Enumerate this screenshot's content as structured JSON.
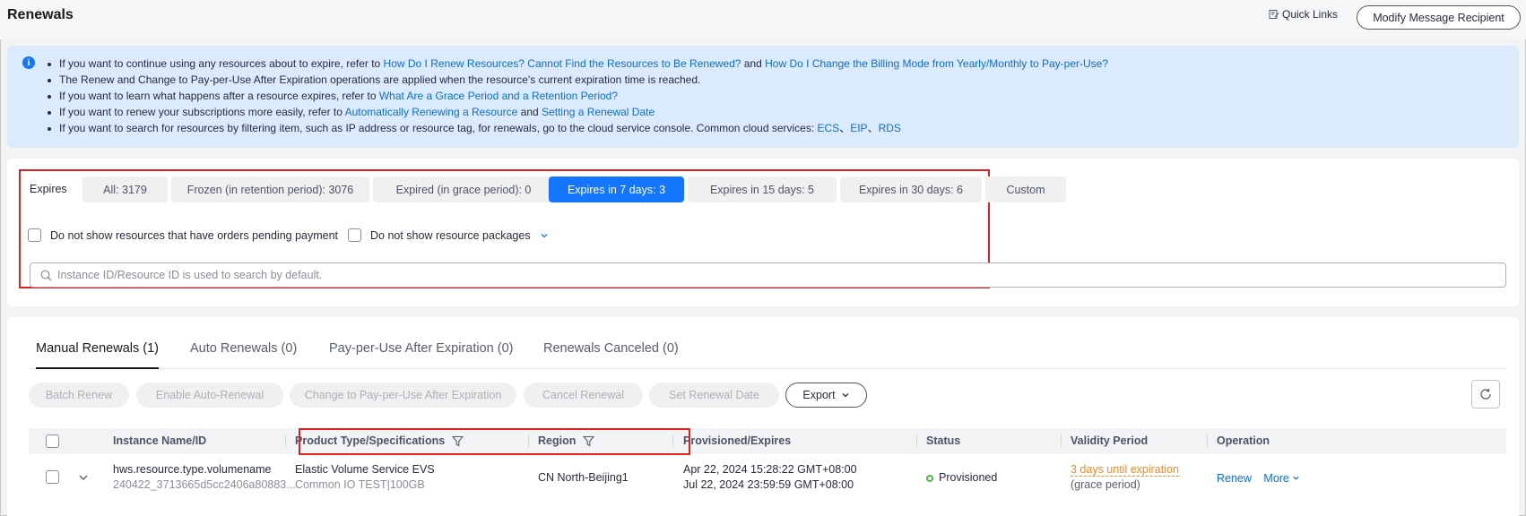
{
  "header": {
    "title": "Renewals",
    "quick_links": "Quick Links",
    "modify_btn": "Modify Message Recipient"
  },
  "info": {
    "lines": [
      {
        "pre": "If you want to continue using any resources about to expire, refer to ",
        "link1": "How Do I Renew Resources? Cannot Find the Resources to Be Renewed?",
        "mid": " and ",
        "link2": "How Do I Change the Billing Mode from Yearly/Monthly to Pay-per-Use?"
      },
      {
        "pre": "The Renew and Change to Pay-per-Use After Expiration operations are applied when the resource's current expiration time is reached."
      },
      {
        "pre": "If you want to learn what happens after a resource expires, refer to ",
        "link1": "What Are a Grace Period and a Retention Period?"
      },
      {
        "pre": "If you want to renew your subscriptions more easily, refer to ",
        "link1": "Automatically Renewing a Resource",
        "mid": " and ",
        "link2": "Setting a Renewal Date"
      },
      {
        "pre": "If you want to search for resources by filtering item, such as IP address or resource tag, for renewals, go to the cloud service console. Common cloud services: ",
        "link1": "ECS",
        "sep1": "、",
        "link2": "EIP",
        "sep2": "、",
        "link3": "RDS"
      }
    ]
  },
  "filters": {
    "expires_label": "Expires",
    "chips": [
      "All: 3179",
      "Frozen (in retention period): 3076",
      "Expired (in grace period): 0",
      "Expires in 7 days: 3",
      "Expires in 15 days: 5",
      "Expires in 30 days: 6",
      "Custom"
    ],
    "active_chip": "Expires in 7 days: 3",
    "check_pending": "Do not show resources that have orders pending payment",
    "check_packages": "Do not show resource packages",
    "search_placeholder": "Instance ID/Resource ID is used to search by default."
  },
  "tabs": [
    "Manual Renewals (1)",
    "Auto Renewals (0)",
    "Pay-per-Use After Expiration (0)",
    "Renewals Canceled (0)"
  ],
  "toolbar": {
    "batch_renew": "Batch Renew",
    "enable_auto": "Enable Auto-Renewal",
    "change_ppu": "Change to Pay-per-Use After Expiration",
    "cancel_renewal": "Cancel Renewal",
    "set_date": "Set Renewal Date",
    "export": "Export"
  },
  "table": {
    "columns": [
      "Instance Name/ID",
      "Product Type/Specifications",
      "Region",
      "Provisioned/Expires",
      "Status",
      "Validity Period",
      "Operation"
    ],
    "rows": [
      {
        "name": "hws.resource.type.volumename",
        "id": "240422_3713665d5cc2406a80883...",
        "product": "Elastic Volume Service EVS",
        "spec": "Common IO TEST|100GB",
        "region": "CN North-Beijing1",
        "provisioned": "Apr 22, 2024 15:28:22 GMT+08:00",
        "expires": "Jul 22, 2024 23:59:59 GMT+08:00",
        "status": "Provisioned",
        "validity": "3 days until expiration",
        "validity_note": "(grace period)",
        "op_renew": "Renew",
        "op_more": "More"
      }
    ]
  },
  "colors": {
    "accent": "#1476ff",
    "highlight_box": "#e02020",
    "warning": "#f6891e",
    "status_ok": "#50b83c"
  }
}
